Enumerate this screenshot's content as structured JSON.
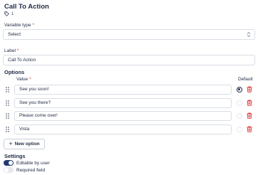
{
  "header": {
    "title": "Call To Action",
    "tag_count": "1"
  },
  "variable_type": {
    "label": "Variable type",
    "required_mark": "*",
    "selected": "Select"
  },
  "label_field": {
    "label": "Label",
    "required_mark": "*",
    "value": "Call To Action"
  },
  "options": {
    "section_title": "Options",
    "value_header": "Value",
    "required_mark": "*",
    "default_header": "Default",
    "items": [
      {
        "value": "See you soon!",
        "is_default": true
      },
      {
        "value": "See you there?",
        "is_default": false
      },
      {
        "value": "Please come over!",
        "is_default": false
      },
      {
        "value": "Vista",
        "is_default": false
      }
    ],
    "new_option_label": "New option"
  },
  "settings": {
    "section_title": "Settings",
    "editable_by_user": {
      "label": "Editable by user",
      "on": true
    },
    "required_field": {
      "label": "Required field",
      "on": false
    }
  },
  "colors": {
    "accent": "#1f3b73",
    "danger": "#e03131",
    "text": "#1f2a44"
  }
}
